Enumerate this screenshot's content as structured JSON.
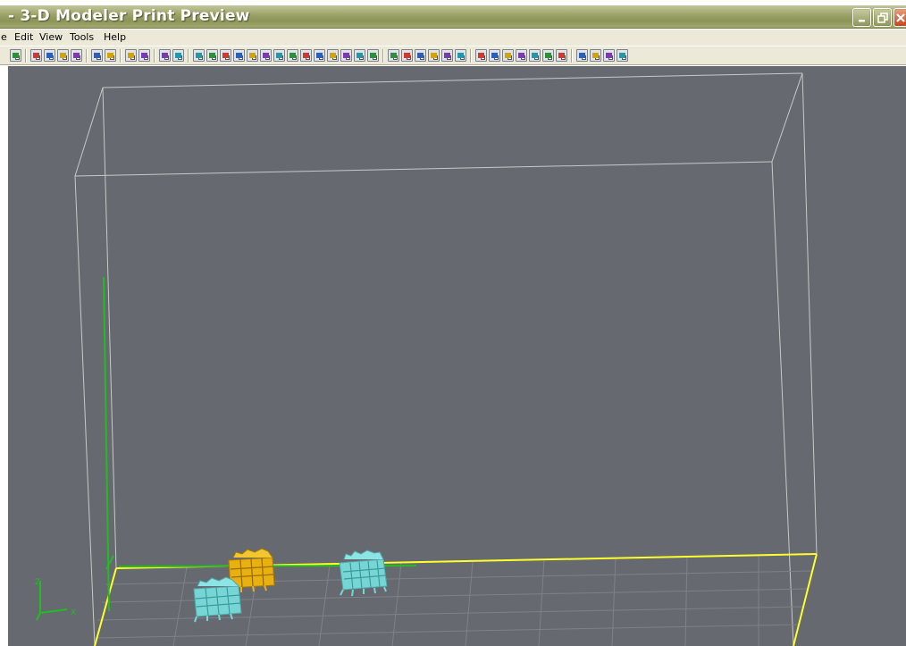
{
  "window": {
    "title": "- 3-D Modeler Print Preview",
    "buttons": [
      "minimize-icon",
      "restore-icon",
      "close-icon"
    ]
  },
  "menu": {
    "items": [
      "e",
      "Edit",
      "View",
      "Tools",
      "Help"
    ]
  },
  "toolbar": {
    "groups": [
      [
        "back-icon"
      ],
      [
        "open-icon",
        "rotate-icon",
        "align-icon",
        "grid-icon"
      ],
      [
        "arrange-icon",
        "pack-icon"
      ],
      [
        "zoom-icon",
        "zoom-window-icon"
      ],
      [
        "stop-icon",
        "build-icon"
      ],
      [
        "view-top-icon",
        "view-front-icon",
        "view-bottom-icon",
        "pan-icon",
        "view-iso-1-icon",
        "view-iso-2-icon",
        "view-iso-3-icon",
        "view-iso-4-icon",
        "view-iso-5-icon",
        "view-iso-6-icon",
        "view-iso-7-icon",
        "view-iso-8-icon",
        "zoom-in-icon",
        "zoom-out-icon"
      ],
      [
        "add-part-icon",
        "part-grid-icon",
        "layers-icon",
        "settings-icon",
        "globe-icon",
        "options-icon"
      ],
      [
        "sparkle-icon",
        "pen-icon",
        "pencil-icon",
        "check-icon",
        "heart-icon",
        "cube-icon",
        "target-icon"
      ],
      [
        "printer-icon",
        "chart-icon",
        "palette-icon",
        "camera-icon"
      ]
    ]
  },
  "viewport": {
    "background": "#666a70",
    "box_color": "#c8c8c8",
    "tray_color": "#ffff2a",
    "axis_color": "#22bb22",
    "axis_labels": {
      "z": "Z",
      "x": "X"
    },
    "parts": [
      {
        "name": "part-yellow",
        "color": "#e8b010"
      },
      {
        "name": "part-cyan-front",
        "color": "#76d6d6"
      },
      {
        "name": "part-cyan-back",
        "color": "#76d6d6"
      }
    ]
  }
}
